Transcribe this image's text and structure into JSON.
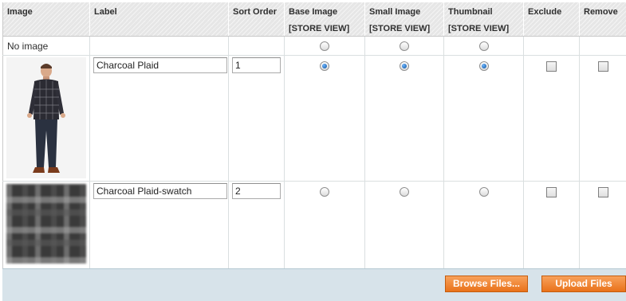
{
  "columns": {
    "image": "Image",
    "label": "Label",
    "sort_order": "Sort Order",
    "base_image": "Base Image",
    "small_image": "Small Image",
    "thumbnail": "Thumbnail",
    "exclude": "Exclude",
    "remove": "Remove",
    "scope": "[STORE VIEW]"
  },
  "no_image": {
    "text": "No image",
    "base_selected": false,
    "small_selected": false,
    "thumbnail_selected": false
  },
  "images": [
    {
      "alt": "model wearing charcoal plaid shirt",
      "label": "Charcoal Plaid",
      "sort_order": "1",
      "base_selected": true,
      "small_selected": true,
      "thumbnail_selected": true,
      "exclude": false,
      "remove": false
    },
    {
      "alt": "charcoal plaid fabric swatch",
      "label": "Charcoal Plaid-swatch",
      "sort_order": "2",
      "base_selected": false,
      "small_selected": false,
      "thumbnail_selected": false,
      "exclude": false,
      "remove": false
    }
  ],
  "buttons": {
    "browse": "Browse Files...",
    "upload": "Upload Files"
  },
  "colors": {
    "button_orange": "#e9721a",
    "footer_bg": "#d7e3ea",
    "header_bg": "#e6e6e6"
  }
}
